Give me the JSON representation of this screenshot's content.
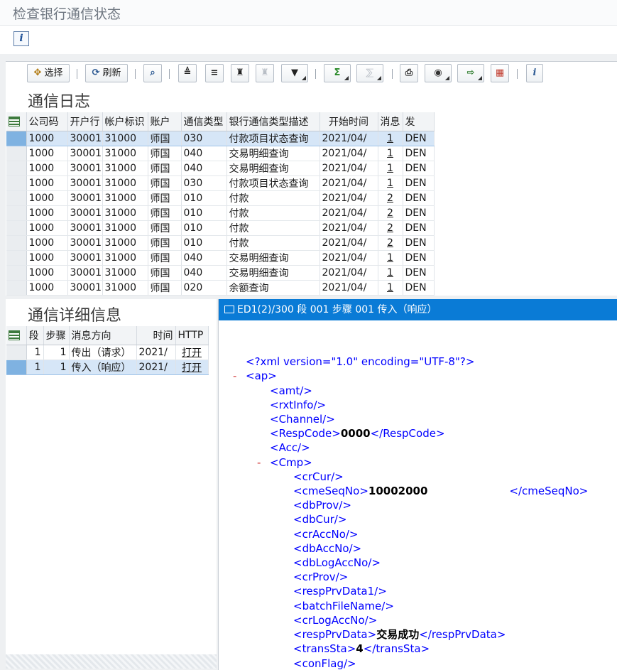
{
  "app": {
    "title": "检查银行通信状态"
  },
  "info_button": {
    "label": "i"
  },
  "toolbar": {
    "select_label": "选择",
    "refresh_label": "刷新"
  },
  "log": {
    "title": "通信日志",
    "columns": [
      "公司码",
      "开户行",
      "帐户标识",
      "账户",
      "通信类型",
      "银行通信类型描述",
      "开始时间",
      "消息",
      "发"
    ],
    "rows": [
      [
        "1000",
        "30001",
        "31000",
        "师国",
        "030",
        "付款项目状态查询",
        "2021/04/",
        "1",
        "DEN"
      ],
      [
        "1000",
        "30001",
        "31000",
        "师国",
        "040",
        "交易明细查询",
        "2021/04/",
        "1",
        "DEN"
      ],
      [
        "1000",
        "30001",
        "31000",
        "师国",
        "040",
        "交易明细查询",
        "2021/04/",
        "1",
        "DEN"
      ],
      [
        "1000",
        "30001",
        "31000",
        "师国",
        "030",
        "付款项目状态查询",
        "2021/04/",
        "1",
        "DEN"
      ],
      [
        "1000",
        "30001",
        "31000",
        "师国",
        "010",
        "付款",
        "2021/04/",
        "2",
        "DEN"
      ],
      [
        "1000",
        "30001",
        "31000",
        "师国",
        "010",
        "付款",
        "2021/04/",
        "2",
        "DEN"
      ],
      [
        "1000",
        "30001",
        "31000",
        "师国",
        "010",
        "付款",
        "2021/04/",
        "2",
        "DEN"
      ],
      [
        "1000",
        "30001",
        "31000",
        "师国",
        "010",
        "付款",
        "2021/04/",
        "2",
        "DEN"
      ],
      [
        "1000",
        "30001",
        "31000",
        "师国",
        "040",
        "交易明细查询",
        "2021/04/",
        "1",
        "DEN"
      ],
      [
        "1000",
        "30001",
        "31000",
        "师国",
        "040",
        "交易明细查询",
        "2021/04/",
        "1",
        "DEN"
      ],
      [
        "1000",
        "30001",
        "31000",
        "师国",
        "020",
        "余额查询",
        "2021/04/",
        "1",
        "DEN"
      ]
    ]
  },
  "detail": {
    "title": "通信详细信息",
    "columns": [
      "段",
      "步骤",
      "消息方向",
      "时间",
      "HTTP"
    ],
    "rows": [
      [
        "1",
        "1",
        "传出（请求）",
        "2021/",
        "打开"
      ],
      [
        "1",
        "1",
        "传入（响应）",
        "2021/",
        "打开"
      ]
    ]
  },
  "xml_panel": {
    "header": "ED1(2)/300 段 001 步骤 001 传入（响应）",
    "toggle": "-",
    "lines": {
      "decl": "<?xml version=\"1.0\" encoding=\"UTF-8\"?>",
      "ap_open": "<ap>",
      "amt": "<amt/>",
      "rxtInfo": "<rxtInfo/>",
      "channel": "<Channel/>",
      "respcode_open": "<RespCode>",
      "respcode_val": "0000",
      "respcode_close": "</RespCode>",
      "acc": "<Acc/>",
      "cmp_open": "<Cmp>",
      "crCur": "<crCur/>",
      "cmeseq_open": "<cmeSeqNo>",
      "cmeseq_val": "10002000",
      "cmeseq_close": "</cmeSeqNo>",
      "dbProv": "<dbProv/>",
      "dbCur": "<dbCur/>",
      "crAccNo": "<crAccNo/>",
      "dbAccNo": "<dbAccNo/>",
      "dbLogAccNo": "<dbLogAccNo/>",
      "crProv": "<crProv/>",
      "respPrvData1": "<respPrvData1/>",
      "batchFileName": "<batchFileName/>",
      "crLogAccNo": "<crLogAccNo/>",
      "resp_open": "<respPrvData>",
      "resp_val": "交易成功",
      "resp_close": "</respPrvData>",
      "transsta_open": "<transSta>",
      "transsta_val": "4",
      "transsta_close": "</transSta>",
      "conFlag": "<conFlag/>"
    }
  }
}
